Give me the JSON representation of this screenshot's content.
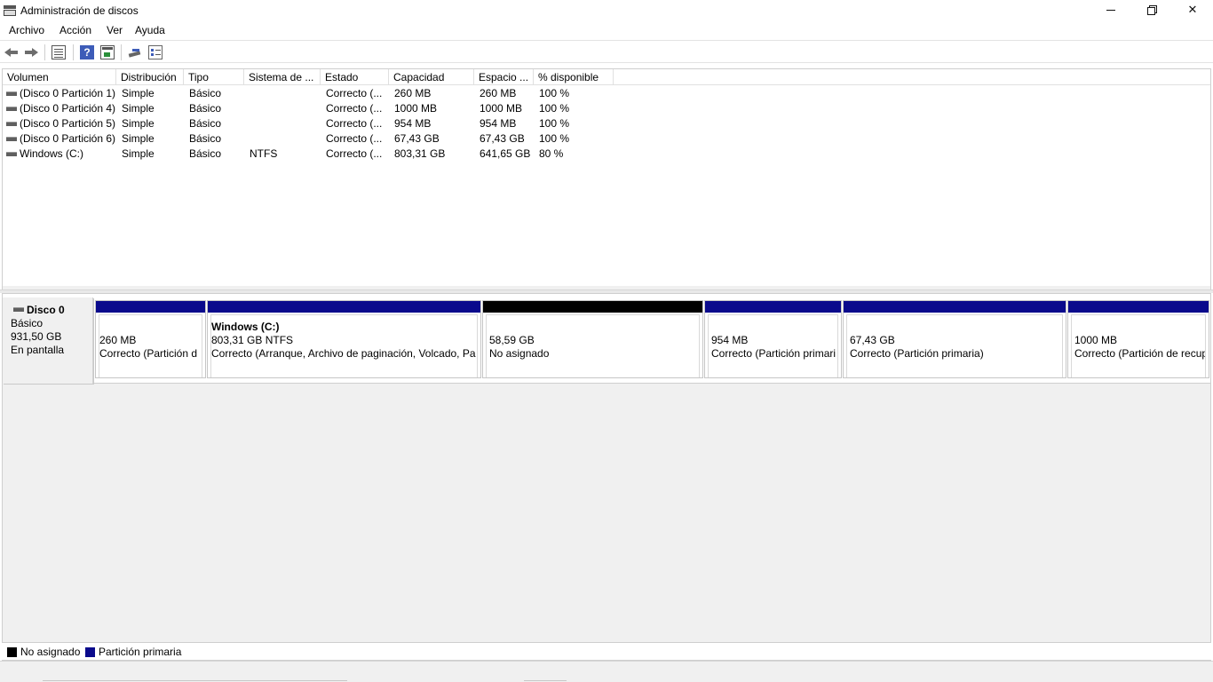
{
  "window": {
    "title": "Administración de discos",
    "icon": "disk-management-icon"
  },
  "menu": [
    "Archivo",
    "Acción",
    "Ver",
    "Ayuda"
  ],
  "toolbar": {
    "icons": [
      "back-arrow-icon",
      "forward-arrow-icon",
      "volume-list-icon",
      "help-icon",
      "properties-icon",
      "rescan-disk-icon",
      "list-view-icon"
    ]
  },
  "volume_table": {
    "columns": [
      "Volumen",
      "Distribución",
      "Tipo",
      "Sistema de ...",
      "Estado",
      "Capacidad",
      "Espacio ...",
      "% disponible"
    ],
    "rows": [
      [
        "(Disco 0 Partición 1)",
        "Simple",
        "Básico",
        "",
        "Correcto (...",
        "260 MB",
        "260 MB",
        "100 %"
      ],
      [
        "(Disco 0 Partición 4)",
        "Simple",
        "Básico",
        "",
        "Correcto (...",
        "1000 MB",
        "1000 MB",
        "100 %"
      ],
      [
        "(Disco 0 Partición 5)",
        "Simple",
        "Básico",
        "",
        "Correcto (...",
        "954 MB",
        "954 MB",
        "100 %"
      ],
      [
        "(Disco 0 Partición 6)",
        "Simple",
        "Básico",
        "",
        "Correcto (...",
        "67,43 GB",
        "67,43 GB",
        "100 %"
      ],
      [
        "Windows (C:)",
        "Simple",
        "Básico",
        "NTFS",
        "Correcto (...",
        "803,31 GB",
        "641,65 GB",
        "80 %"
      ]
    ]
  },
  "disk": {
    "name": "Disco 0",
    "type": "Básico",
    "size": "931,50 GB",
    "status": "En pantalla",
    "partitions": [
      {
        "title": "",
        "size": "260 MB",
        "status": "Correcto (Partición d",
        "kind": "primary"
      },
      {
        "title": "Windows  (C:)",
        "size": "803,31 GB NTFS",
        "status": "Correcto (Arranque, Archivo de paginación, Volcado, Pa",
        "kind": "primary"
      },
      {
        "title": "",
        "size": "58,59 GB",
        "status": "No asignado",
        "kind": "unallocated"
      },
      {
        "title": "",
        "size": "954 MB",
        "status": "Correcto (Partición primari",
        "kind": "primary"
      },
      {
        "title": "",
        "size": "67,43 GB",
        "status": "Correcto (Partición primaria)",
        "kind": "primary"
      },
      {
        "title": "",
        "size": "1000 MB",
        "status": "Correcto (Partición de recup",
        "kind": "primary"
      }
    ]
  },
  "legend": [
    {
      "label": "No asignado",
      "color": "#000000"
    },
    {
      "label": "Partición primaria",
      "color": "#0a0a8c"
    }
  ],
  "colors": {
    "primary_partition": "#0a0a8c",
    "unallocated": "#000000"
  }
}
